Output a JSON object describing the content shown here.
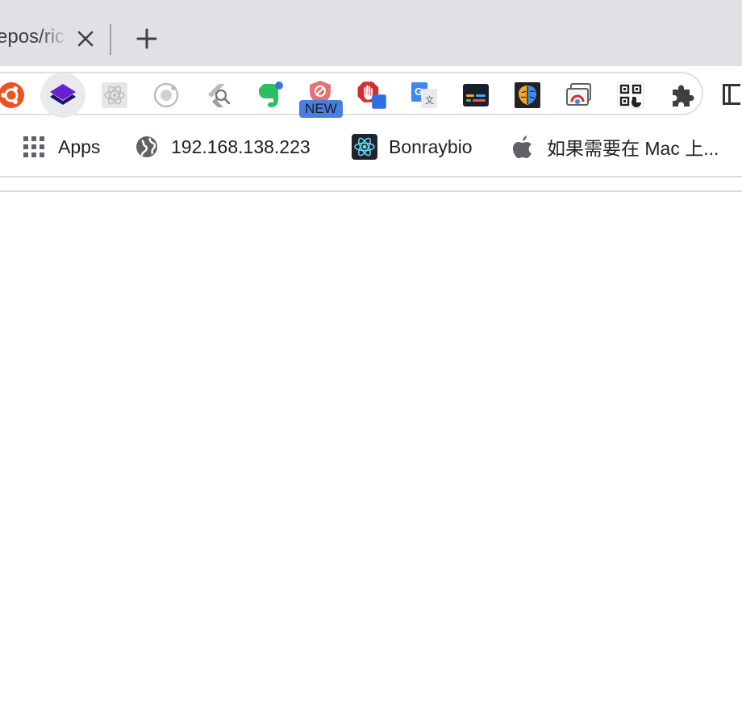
{
  "tab": {
    "title": "epos/ric",
    "close_icon": "close-icon",
    "new_tab_icon": "plus-icon"
  },
  "toolbar": {
    "extensions": [
      {
        "name": "ubuntu-ext-icon",
        "color": "#e95420"
      },
      {
        "name": "layers-ext-icon",
        "color": "#4b1d9a"
      },
      {
        "name": "react-devtools-icon",
        "color": "#9e9e9e"
      },
      {
        "name": "ionic-ext-icon",
        "color": "#9e9e9e"
      },
      {
        "name": "flutter-inspector-icon",
        "color": "#9e9e9e"
      },
      {
        "name": "evernote-icon",
        "color": "#2dbe60"
      },
      {
        "name": "blocker-shield-icon",
        "color": "#e57373"
      },
      {
        "name": "adblock-hand-icon",
        "color": "#d32f2f"
      },
      {
        "name": "google-translate-icon",
        "color": "#4285f4"
      },
      {
        "name": "terminal-ext-icon",
        "color": "#1a1a2e"
      },
      {
        "name": "brain-ext-icon",
        "color": "#1565c0"
      },
      {
        "name": "window-chrome-icon",
        "color": "#757575"
      },
      {
        "name": "qr-code-icon",
        "color": "#212121"
      },
      {
        "name": "puzzle-extensions-icon",
        "color": "#3c4043"
      }
    ],
    "new_badge": "NEW"
  },
  "bookmarks": [
    {
      "label": "Apps",
      "icon": "apps-grid-icon"
    },
    {
      "label": "192.168.138.223",
      "icon": "globe-icon"
    },
    {
      "label": "Bonraybio",
      "icon": "react-logo-icon"
    },
    {
      "label": "如果需要在 Mac 上...",
      "icon": "apple-icon"
    }
  ]
}
